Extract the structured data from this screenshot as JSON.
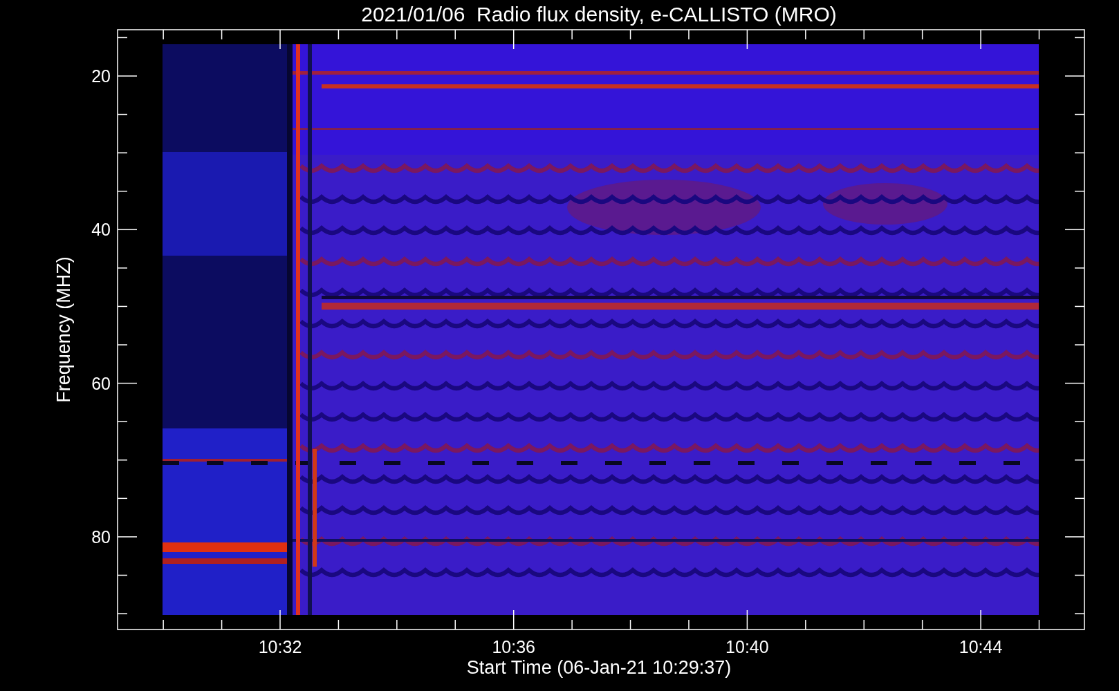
{
  "title": "2021/01/06  Radio flux density, e-CALLISTO (MRO)",
  "y_axis": {
    "label": "Frequency (MHZ)",
    "ticks": [
      "20",
      "40",
      "60",
      "80"
    ]
  },
  "x_axis": {
    "label": "Start Time (06-Jan-21 10:29:37)",
    "ticks": [
      "10:32",
      "10:36",
      "10:40",
      "10:44"
    ]
  }
}
